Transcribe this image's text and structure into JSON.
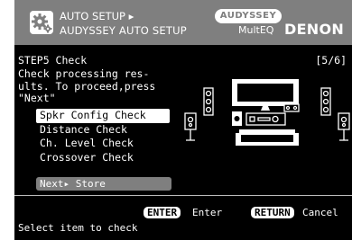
{
  "header": {
    "line1": "AUTO SETUP ▸",
    "line2": "AUDYSSEY AUTO SETUP",
    "brand_badge": "AUDYSSEY",
    "multeq": "MultEQ",
    "brand": "DENON"
  },
  "step": {
    "title": "STEP5 Check",
    "counter": "[5/6]",
    "description": "Check processing res-\nults. To proceed,press\n\"Next\""
  },
  "menu": {
    "items": [
      {
        "label": "Spkr Config Check"
      },
      {
        "label": "Distance Check"
      },
      {
        "label": "Ch.  Level Check"
      },
      {
        "label": "Crossover Check"
      }
    ],
    "selected_index": 0,
    "next_label": "Next▸ Store"
  },
  "footer": {
    "enter_key": "ENTER",
    "enter_label": "Enter",
    "return_key": "RETURN",
    "return_label": "Cancel",
    "hint": "Select item to check"
  },
  "colors": {
    "background": "#000000",
    "header": "#7f7f7f",
    "text": "#ffffff"
  },
  "icons": [
    "gear-icon",
    "speaker-layout-diagram"
  ]
}
